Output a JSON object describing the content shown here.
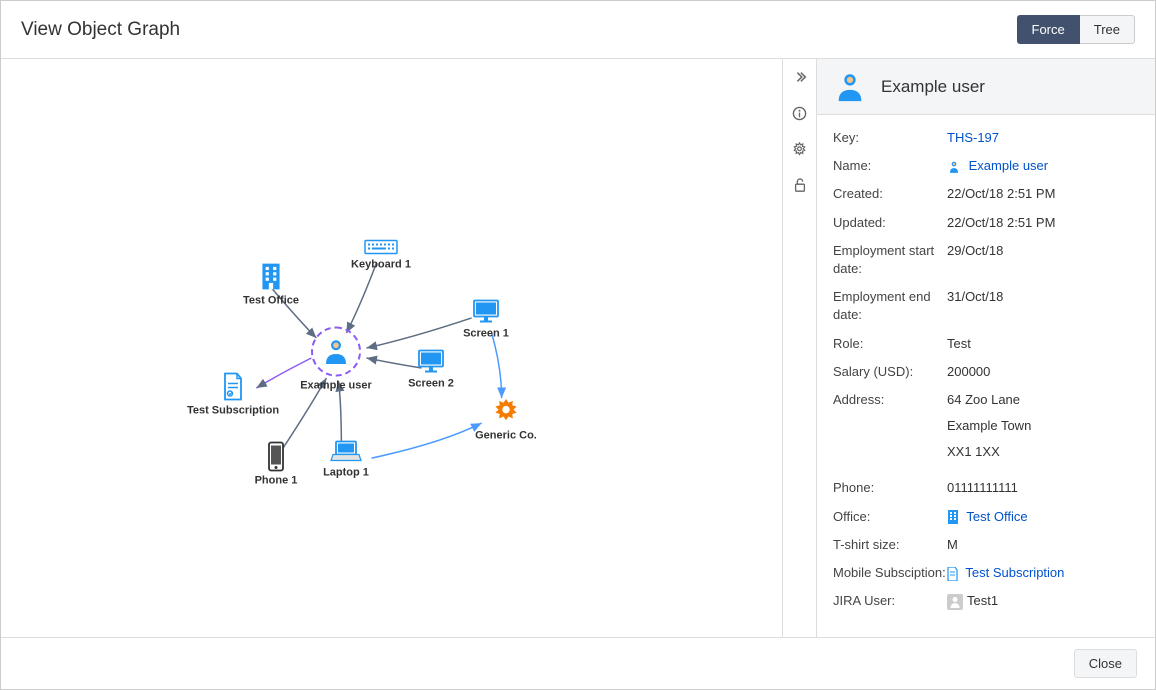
{
  "header": {
    "title": "View Object Graph",
    "force_label": "Force",
    "tree_label": "Tree"
  },
  "graph": {
    "nodes": {
      "example_user": "Example user",
      "keyboard": "Keyboard 1",
      "test_office": "Test Office",
      "screen1": "Screen 1",
      "screen2": "Screen 2",
      "generic_co": "Generic Co.",
      "laptop": "Laptop 1",
      "phone": "Phone 1",
      "test_subscription": "Test Subscription"
    }
  },
  "details": {
    "title": "Example user",
    "fields": {
      "key_label": "Key:",
      "key_value": "THS-197",
      "name_label": "Name:",
      "name_value": "Example user",
      "created_label": "Created:",
      "created_value": "22/Oct/18 2:51 PM",
      "updated_label": "Updated:",
      "updated_value": "22/Oct/18 2:51 PM",
      "emp_start_label": "Employment start date:",
      "emp_start_value": "29/Oct/18",
      "emp_end_label": "Employment end date:",
      "emp_end_value": "31/Oct/18",
      "role_label": "Role:",
      "role_value": "Test",
      "salary_label": "Salary (USD):",
      "salary_value": "200000",
      "address_label": "Address:",
      "address_line1": "64 Zoo Lane",
      "address_line2": "Example Town",
      "address_line3": "XX1 1XX",
      "phone_label": "Phone:",
      "phone_value": "01111111111",
      "office_label": "Office:",
      "office_value": "Test Office",
      "tshirt_label": "T-shirt size:",
      "tshirt_value": "M",
      "mobile_sub_label": "Mobile Subsciption:",
      "mobile_sub_value": "Test Subscription",
      "jira_label": "JIRA User:",
      "jira_value": "Test1"
    }
  },
  "footer": {
    "close_label": "Close"
  }
}
